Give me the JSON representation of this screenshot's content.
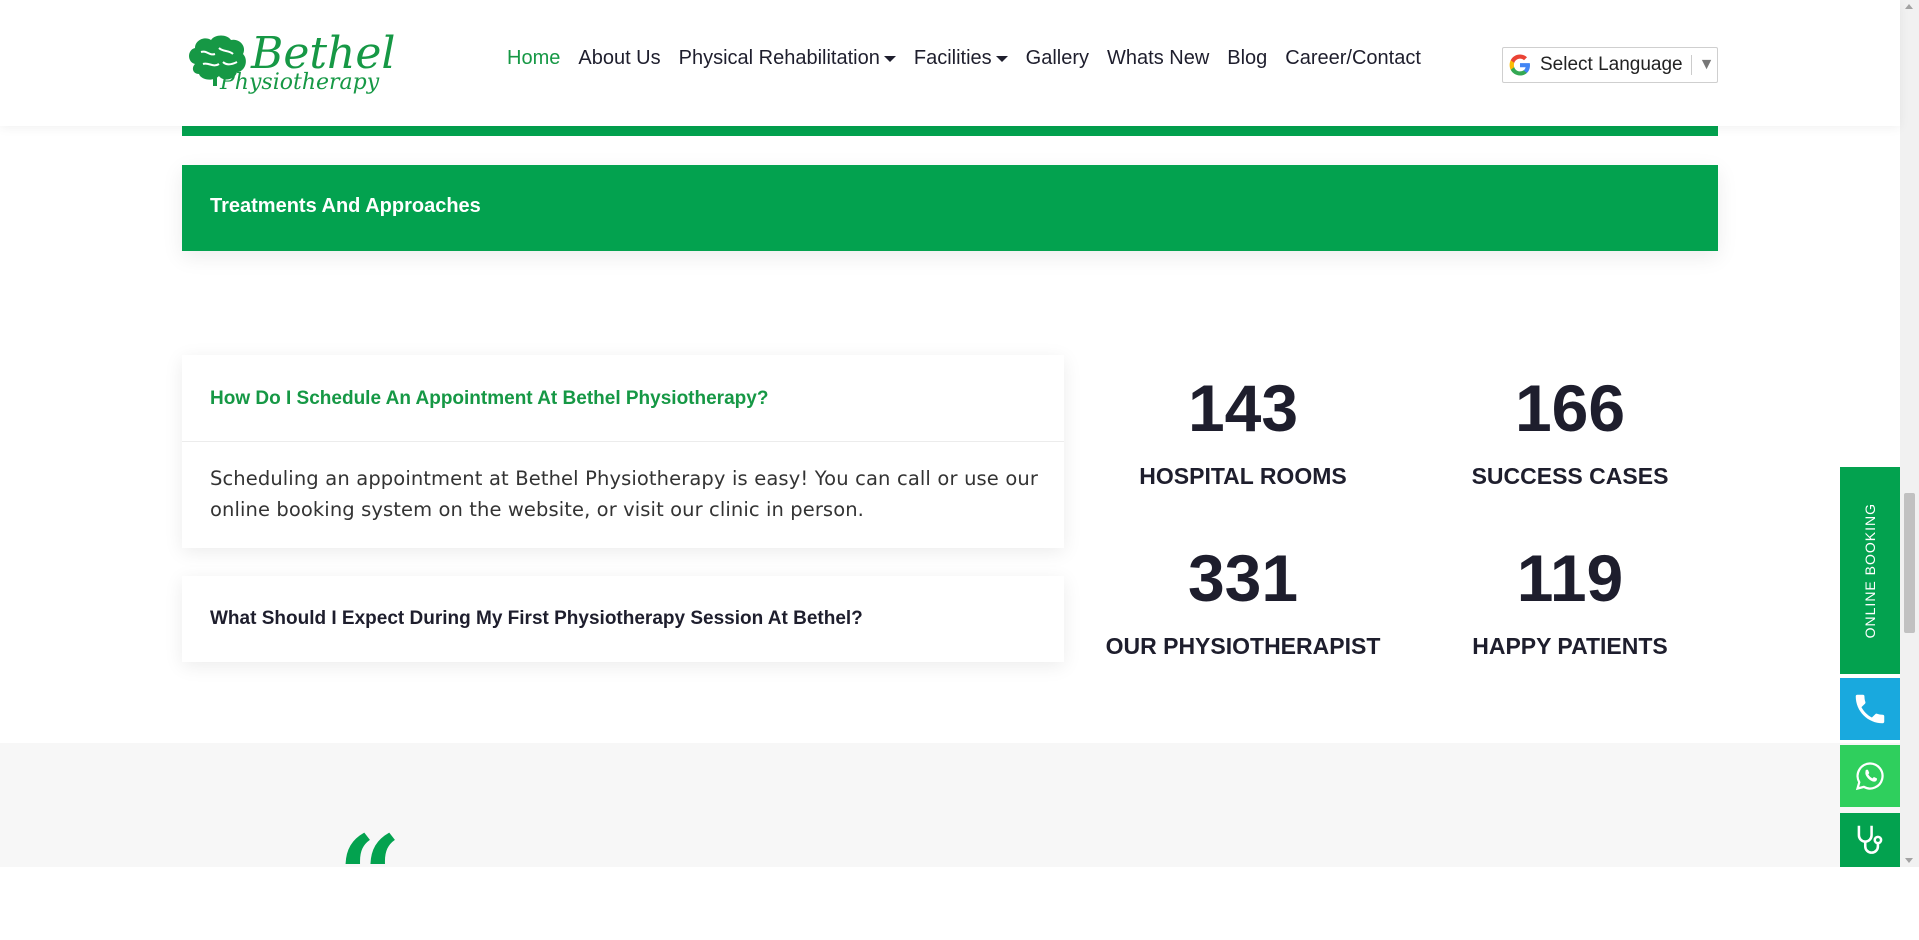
{
  "brand": {
    "name": "Bethel",
    "tagline": "Physiotherapy"
  },
  "nav": {
    "items": [
      {
        "label": "Home",
        "active": true,
        "dropdown": false
      },
      {
        "label": "About Us",
        "dropdown": false
      },
      {
        "label": "Physical Rehabilitation",
        "dropdown": true
      },
      {
        "label": "Facilities",
        "dropdown": true
      },
      {
        "label": "Gallery",
        "dropdown": false
      },
      {
        "label": "Whats New",
        "dropdown": false
      },
      {
        "label": "Blog",
        "dropdown": false
      },
      {
        "label": "Career/Contact",
        "dropdown": false
      }
    ]
  },
  "language": {
    "label": "Select Language",
    "arrow": "▼",
    "icon": "google-icon"
  },
  "treatments": {
    "title": "Treatments And Approaches"
  },
  "faq": [
    {
      "question": "How Do I Schedule An Appointment At Bethel Physiotherapy?",
      "answer": "Scheduling an appointment at Bethel Physiotherapy is easy! You can call or use our online booking system on the website, or visit our clinic in person.",
      "expanded": true
    },
    {
      "question": "What Should I Expect During My First Physiotherapy Session At Bethel?",
      "expanded": false
    }
  ],
  "stats": [
    {
      "number": "143",
      "label": "HOSPITAL ROOMS"
    },
    {
      "number": "166",
      "label": "SUCCESS CASES"
    },
    {
      "number": "331",
      "label": "OUR PHYSIOTHERAPIST"
    },
    {
      "number": "119",
      "label": "HAPPY PATIENTS"
    }
  ],
  "testimonial": {
    "quote_mark": "“"
  },
  "side_buttons": {
    "booking_label": "ONLINE BOOKING",
    "phone_icon": "phone-icon",
    "whatsapp_icon": "whatsapp-icon",
    "doctor_icon": "stethoscope-icon"
  },
  "colors": {
    "brand_green": "#03a24f",
    "phone_blue": "#19a9de",
    "whatsapp_green": "#2fcf5d"
  }
}
